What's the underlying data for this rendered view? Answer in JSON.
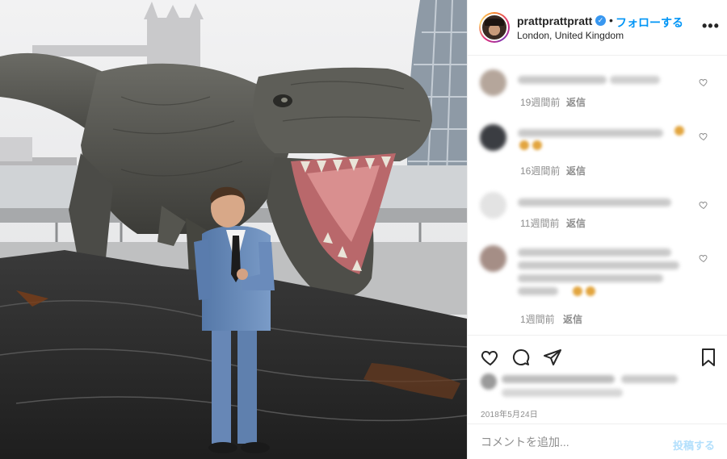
{
  "colors": {
    "accent": "#0095f6",
    "post_disabled": "#b2dffc",
    "muted": "#8e8e8e",
    "border": "#efefef"
  },
  "post": {
    "image_alt": "",
    "icons": [
      "sky",
      "tower-bridge",
      "gherkin-building",
      "t-rex-statue",
      "man-in-blue-suit",
      "rock-platform"
    ]
  },
  "header": {
    "username": "prattprattpratt",
    "verified_icon": "verified-check-icon",
    "separator": "•",
    "follow_label": "フォローする",
    "location": "London, United Kingdom",
    "more_icon": "ellipsis-icon"
  },
  "comments": [
    {
      "time": "19週間前",
      "reply_label": "返信",
      "heart_icon": "heart-outline-icon"
    },
    {
      "time": "16週間前",
      "reply_label": "返信",
      "heart_icon": "heart-outline-icon"
    },
    {
      "time": "11週間前",
      "reply_label": "返信",
      "heart_icon": "heart-outline-icon"
    },
    {
      "time": "1週間前",
      "reply_label": "返信",
      "heart_icon": "heart-outline-icon"
    }
  ],
  "actions": {
    "like_icon": "heart-outline-icon",
    "comment_icon": "comment-bubble-icon",
    "share_icon": "paper-plane-icon",
    "save_icon": "bookmark-icon"
  },
  "date": "2018年5月24日",
  "add_comment": {
    "placeholder": "コメントを追加...",
    "post_label": "投稿する"
  }
}
